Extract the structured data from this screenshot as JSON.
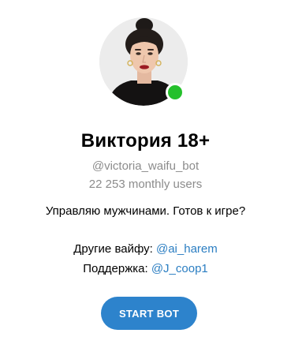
{
  "colors": {
    "link": "#2b7ec2",
    "secondary_text": "#8c8c8c",
    "button_bg": "#2d83cc",
    "online": "#24c02b"
  },
  "bot": {
    "avatar_icon": "woman-portrait-avatar",
    "title": "Виктория 18+",
    "username": "@victoria_waifu_bot",
    "monthly_users": "22 253 monthly users",
    "online_icon": "online-status-icon"
  },
  "description": {
    "line1": "Управляю мужчинами. Готов к игре?",
    "other_label": "Другие вайфу: ",
    "other_link": "@ai_harem",
    "support_label": "Поддержка: ",
    "support_link": "@J_coop1"
  },
  "start_button": {
    "label": "START BOT"
  }
}
